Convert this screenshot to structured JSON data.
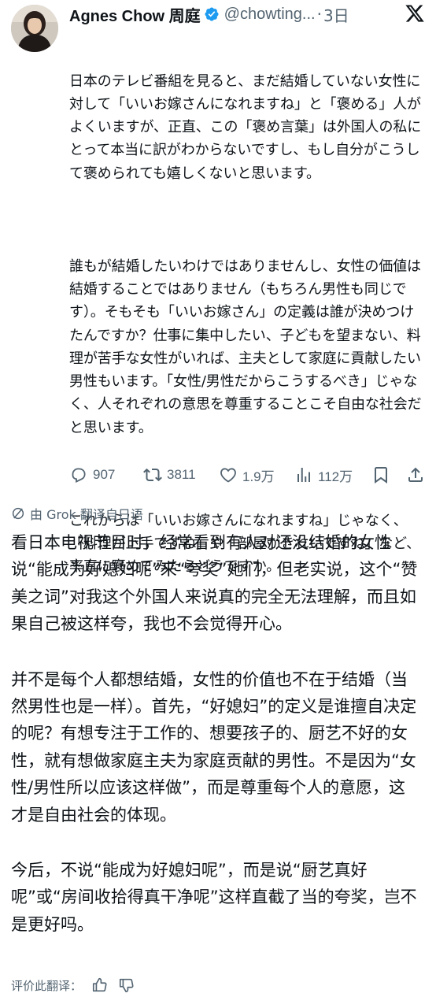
{
  "author": {
    "display_name": "Agnes Chow 周庭",
    "handle": "@chowting...",
    "separator": "·",
    "time": "3日"
  },
  "tweet": {
    "paragraphs": [
      "日本のテレビ番組を見ると、まだ結婚していない女性に対して「いいお嫁さんになれますね」と「褒める」人がよくいますが、正直、この「褒め言葉」は外国人の私にとって本当に訳がわからないですし、もし自分がこうして褒められても嬉しくないと思います。",
      "誰もが結婚したいわけではありませんし、女性の価値は結婚することではありません（もちろん男性も同じです）。そもそも「いいお嫁さん」の定義は誰が決めつけたんですか？仕事に集中したい、子どもを望まない、料理が苦手な女性がいれば、主夫として家庭に貢献したい男性もいます。「女性/男性だからこうするべき」じゃなく、人それぞれの意思を尊重することこそ自由な社会だと思います。",
      "これからは「いいお嫁さんになれますね」じゃなく、「料理が上手ですね」や「部屋がきれいですね」など、率直に褒めてみたらどうですか。"
    ]
  },
  "actions": {
    "replies": "907",
    "reposts": "3811",
    "likes": "1.9万",
    "views": "112万"
  },
  "translation": {
    "label": "由 Grok 翻译自日语",
    "paragraphs": [
      "看日本电视节目时，经常看到有人对还没结婚的女性说“能成为好媳妇呢”来“夸奖”她们，但老实说，这个“赞美之词”对我这个外国人来说真的完全无法理解，而且如果自己被这样夸，我也不会觉得开心。",
      "并不是每个人都想结婚，女性的价值也不在于结婚（当然男性也是一样）。首先，“好媳妇”的定义是谁擅自决定的呢？有想专注于工作的、想要孩子的、厨艺不好的女性，就有想做家庭主夫为家庭贡献的男性。不是因为“女性/男性所以应该这样做”，而是尊重每个人的意愿，这才是自由社会的体现。",
      "今后，不说“能成为好媳妇呢”，而是说“厨艺真好呢”或“房间收拾得真干净呢”这样直截了当的夸奖，岂不是更好吗。"
    ],
    "rate_label": "评价此翻译："
  },
  "colors": {
    "text": "#0f1419",
    "secondary": "#536471",
    "verified": "#1d9bf0"
  }
}
